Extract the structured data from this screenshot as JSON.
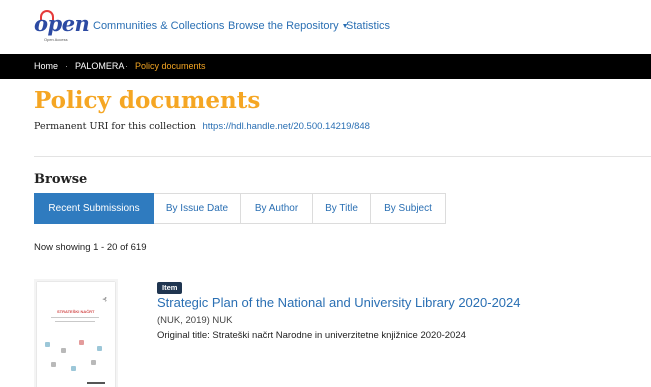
{
  "header": {
    "logo": {
      "word": "open",
      "subtitle": "Open Access"
    },
    "nav": [
      {
        "label": "Communities & Collections"
      },
      {
        "label": "Browse the Repository",
        "has_dropdown": true
      },
      {
        "label": "Statistics"
      }
    ]
  },
  "breadcrumb": {
    "items": [
      "Home",
      "PALOMERA",
      "Policy documents"
    ],
    "separator": "·"
  },
  "collection": {
    "title": "Policy documents",
    "uri_label": "Permanent URI for this collection",
    "uri": "https://hdl.handle.net/20.500.14219/848"
  },
  "browse": {
    "heading": "Browse",
    "tabs": [
      {
        "label": "Recent Submissions",
        "active": true
      },
      {
        "label": "By Issue Date"
      },
      {
        "label": "By Author"
      },
      {
        "label": "By Title"
      },
      {
        "label": "By Subject"
      }
    ]
  },
  "results": {
    "showing": "Now showing 1 - 20 of 619"
  },
  "items": [
    {
      "badge": "Item",
      "title": "Strategic Plan of the National and University Library 2020-2024",
      "meta": "(NUK, 2019) NUK",
      "original_title": "Original title: Strateški načrt Narodne in univerzitetne knjižnice 2020-2024",
      "thumbnail_heading": "STRATEŠKI NAČRT"
    }
  ],
  "colors": {
    "accent_orange": "#f5a623",
    "link_blue": "#2a6fb3",
    "active_tab": "#2f7bbf",
    "badge": "#1f3550",
    "breadcrumb_bar": "#000000"
  }
}
